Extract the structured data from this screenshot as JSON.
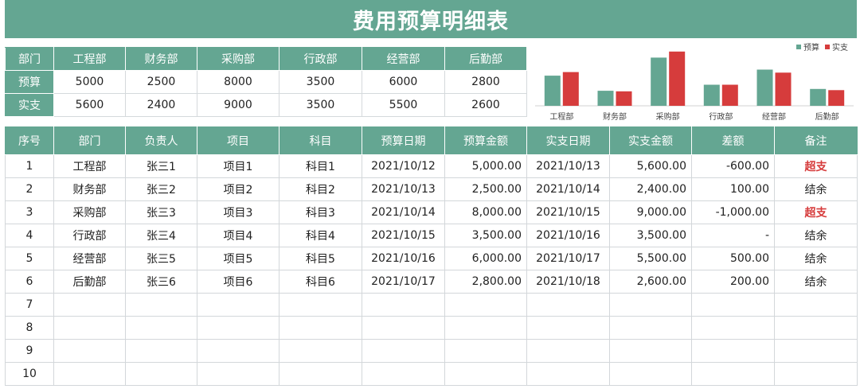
{
  "title": "费用预算明细表",
  "summary": {
    "header_label": "部门",
    "departments": [
      "工程部",
      "财务部",
      "采购部",
      "行政部",
      "经营部",
      "后勤部"
    ],
    "rows": [
      {
        "label": "预算",
        "values": [
          "5000",
          "2500",
          "8000",
          "3500",
          "6000",
          "2800"
        ]
      },
      {
        "label": "实支",
        "values": [
          "5600",
          "2400",
          "9000",
          "3500",
          "5500",
          "2600"
        ]
      }
    ]
  },
  "chart_data": {
    "type": "bar",
    "categories": [
      "工程部",
      "财务部",
      "采购部",
      "行政部",
      "经营部",
      "后勤部"
    ],
    "series": [
      {
        "name": "预算",
        "values": [
          5000,
          2500,
          8000,
          3500,
          6000,
          2800
        ],
        "color": "#64a692"
      },
      {
        "name": "实支",
        "values": [
          5600,
          2400,
          9000,
          3500,
          5500,
          2600
        ],
        "color": "#d63c3c"
      }
    ],
    "ylim": [
      0,
      9500
    ],
    "legend": "top-right"
  },
  "detail": {
    "columns": [
      "序号",
      "部门",
      "负责人",
      "项目",
      "科目",
      "预算日期",
      "预算金额",
      "实支日期",
      "实支金额",
      "差额",
      "备注"
    ],
    "rows": [
      [
        "1",
        "工程部",
        "张三1",
        "项目1",
        "科目1",
        "2021/10/12",
        "5,000.00",
        "2021/10/13",
        "5,600.00",
        "-600.00",
        "超支"
      ],
      [
        "2",
        "财务部",
        "张三2",
        "项目2",
        "科目2",
        "2021/10/13",
        "2,500.00",
        "2021/10/14",
        "2,400.00",
        "100.00",
        "结余"
      ],
      [
        "3",
        "采购部",
        "张三3",
        "项目3",
        "科目3",
        "2021/10/14",
        "8,000.00",
        "2021/10/15",
        "9,000.00",
        "-1,000.00",
        "超支"
      ],
      [
        "4",
        "行政部",
        "张三4",
        "项目4",
        "科目4",
        "2021/10/15",
        "3,500.00",
        "2021/10/16",
        "3,500.00",
        "-",
        "结余"
      ],
      [
        "5",
        "经营部",
        "张三5",
        "项目5",
        "科目5",
        "2021/10/16",
        "6,000.00",
        "2021/10/17",
        "5,500.00",
        "500.00",
        "结余"
      ],
      [
        "6",
        "后勤部",
        "张三6",
        "项目6",
        "科目6",
        "2021/10/17",
        "2,800.00",
        "2021/10/18",
        "2,600.00",
        "200.00",
        "结余"
      ],
      [
        "7",
        "",
        "",
        "",
        "",
        "",
        "",
        "",
        "",
        "",
        ""
      ],
      [
        "8",
        "",
        "",
        "",
        "",
        "",
        "",
        "",
        "",
        "",
        ""
      ],
      [
        "9",
        "",
        "",
        "",
        "",
        "",
        "",
        "",
        "",
        "",
        ""
      ],
      [
        "10",
        "",
        "",
        "",
        "",
        "",
        "",
        "",
        "",
        "",
        ""
      ]
    ],
    "overspend_label": "超支"
  }
}
